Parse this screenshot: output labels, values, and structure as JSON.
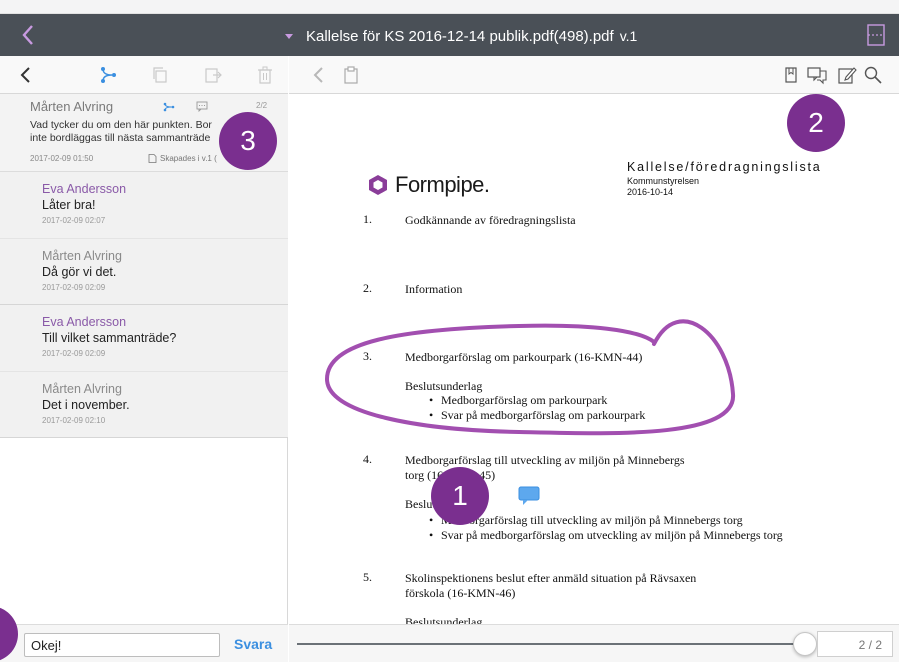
{
  "window": {
    "title": "Kallelse för KS 2016-12-14 publik.pdf(498).pdf",
    "version": "v.1"
  },
  "thread": {
    "author": "Mårten Alvring",
    "text_line1": "Vad tycker du om den här punkten. Bor",
    "text_line2": "inte bordläggas till nästa sammanträde",
    "date": "2017-02-09 01:50",
    "created_label": "Skapades i v.1 (",
    "count": "2/2"
  },
  "replies": [
    {
      "group": 1,
      "items": [
        {
          "author": "Eva Andersson",
          "text": "Låter bra!",
          "date": "2017-02-09 02:07"
        },
        {
          "author": "Mårten Alvring",
          "text": "Då gör vi det.",
          "date": "2017-02-09 02:09"
        }
      ]
    },
    {
      "group": 2,
      "items": [
        {
          "author": "Eva Andersson",
          "text": "Till vilket sammanträde?",
          "date": "2017-02-09 02:09"
        },
        {
          "author": "Mårten Alvring",
          "text": "Det i november.",
          "date": "2017-02-09 02:10"
        }
      ]
    }
  ],
  "reply_bar": {
    "input_value": "Okej!",
    "send_label": "Svara"
  },
  "document": {
    "logo_text": "Formpipe.",
    "header_title": "Kallelse/föredragningslista",
    "header_org": "Kommunstyrelsen",
    "header_date": "2016-10-14",
    "items": [
      {
        "num": "1.",
        "text": "Godkännande av föredragningslista"
      },
      {
        "num": "2.",
        "text": "Information"
      },
      {
        "num": "3.",
        "text": "Medborgarförslag om parkourpark (16-KMN-44)"
      },
      {
        "num": "4.",
        "text": "Medborgarförslag till utveckling av miljön på Minnebergs"
      },
      {
        "num": "5.",
        "text": "Skolinspektionens beslut efter anmäld situation på Rävsaxen"
      }
    ],
    "item3_sub": "Beslutsunderlag",
    "item3_bullets": [
      "Medborgarförslag om parkourpark",
      "Svar på medborgarförslag om parkourpark"
    ],
    "item4_line2": "torg (16-KMN-45)",
    "item4_sub": "Beslutsunderlag",
    "item4_bullets": [
      "Medborgarförslag till utveckling av miljön på Minnebergs torg",
      "Svar på medborgarförslag om utveckling av miljön på Minnebergs torg"
    ],
    "item5_line2": "förskola (16-KMN-46)",
    "item5_sub": "Beslutsunderlag"
  },
  "pager": {
    "page_label": "2 / 2",
    "progress": 1.0
  },
  "callouts": [
    "1",
    "2",
    "3"
  ],
  "colors": {
    "title_bar": "#4a5057",
    "accent_purple": "#7a2f8f",
    "link_blue": "#3b8fe0",
    "name_purple": "#8a5aa8",
    "annotation_stroke": "#a24fb0"
  }
}
